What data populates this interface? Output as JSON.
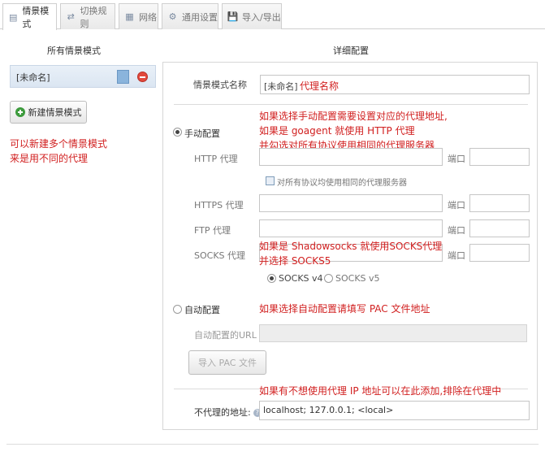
{
  "tabs": [
    {
      "label": "情景模式",
      "icon": "profile-icon",
      "active": true
    },
    {
      "label": "切换规则",
      "icon": "switch-rules-icon",
      "active": false
    },
    {
      "label": "网络",
      "icon": "network-icon",
      "active": false
    },
    {
      "label": "通用设置",
      "icon": "gear-icon",
      "active": false
    },
    {
      "label": "导入/导出",
      "icon": "import-export-icon",
      "active": false
    }
  ],
  "left": {
    "title": "所有情景模式",
    "profile": {
      "name": "[未命名]",
      "color": "#8ab4dc"
    },
    "new_button": "新建情景模式",
    "note_lines": [
      "可以新建多个情景模式",
      "来是用不同的代理"
    ]
  },
  "right": {
    "title": "详细配置",
    "name_label": "情景模式名称",
    "name_value": "[未命名]",
    "name_annotation": "代理名称",
    "manual": {
      "label": "手动配置",
      "selected": true,
      "annotation_lines": [
        "如果选择手动配置需要设置对应的代理地址,",
        "如果是 goagent 就使用 HTTP 代理",
        "并勾选对所有协议使用相同的代理服务器"
      ],
      "http_label": "HTTP 代理",
      "port_label": "端口",
      "same_proxy_label": "对所有协议均使用相同的代理服务器",
      "https_label": "HTTPS 代理",
      "ftp_label": "FTP 代理",
      "socks_label": "SOCKS 代理",
      "socks_annotation_lines": [
        "如果是 Shadowsocks 就使用SOCKS代理",
        "并选择 SOCKS5"
      ],
      "socks_v4": "SOCKS v4",
      "socks_v5": "SOCKS v5",
      "socks_selected": "SOCKS v4"
    },
    "auto": {
      "label": "自动配置",
      "selected": false,
      "annotation": "如果选择自动配置请填写 PAC 文件地址",
      "url_label": "自动配置的URL",
      "import_button": "导入 PAC 文件"
    },
    "bypass": {
      "annotation": "如果有不想使用代理 IP 地址可以在此添加,排除在代理中",
      "label": "不代理的地址:",
      "value": "localhost; 127.0.0.1; <local>"
    }
  },
  "colors": {
    "annotation": "#d11f1f",
    "accent": "#8ab4dc"
  }
}
